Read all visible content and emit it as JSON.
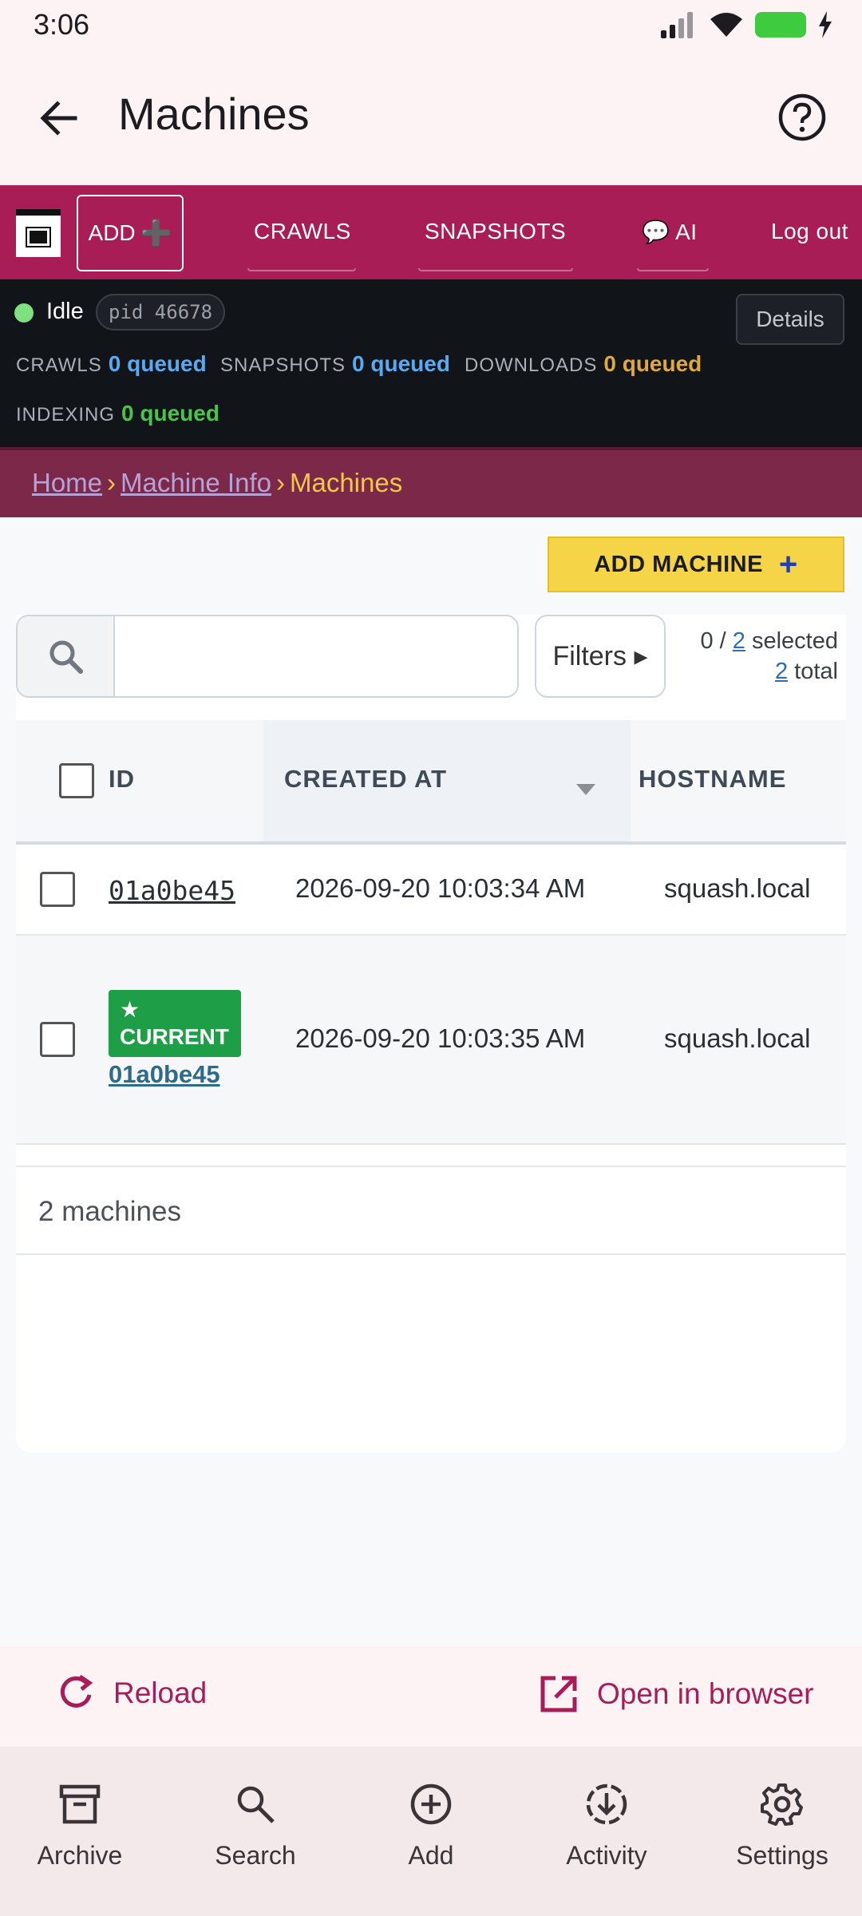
{
  "status_bar": {
    "time": "3:06"
  },
  "app_bar": {
    "title": "Machines"
  },
  "web_nav": {
    "add_label": "ADD",
    "links": [
      "CRAWLS",
      "SNAPSHOTS",
      "💬 AI"
    ],
    "logout": "Log out"
  },
  "worker_status": {
    "state": "Idle",
    "pid": "pid 46678",
    "details": "Details",
    "queues": [
      {
        "label": "CRAWLS",
        "value": "0 queued",
        "color": "#5aaaf0"
      },
      {
        "label": "SNAPSHOTS",
        "value": "0 queued",
        "color": "#5aaaf0"
      },
      {
        "label": "DOWNLOADS",
        "value": "0 queued",
        "color": "#e0a93b"
      },
      {
        "label": "INDEXING",
        "value": "0 queued",
        "color": "#4cc44c"
      }
    ]
  },
  "breadcrumb": {
    "home": "Home",
    "sep": "›",
    "machine_info": "Machine Info",
    "current": "Machines"
  },
  "toolbar": {
    "add_machine": "ADD MACHINE",
    "filters": "Filters ▸"
  },
  "selection": {
    "selected": "0",
    "of": "2",
    "selected_label": "selected",
    "total": "2",
    "total_label": "total"
  },
  "table": {
    "columns": [
      "ID",
      "CREATED AT",
      "HOSTNAME"
    ],
    "rows": [
      {
        "id": "01a0be45",
        "created_at": "2026-09-20 10:03:34 AM",
        "hostname": "squash.local",
        "current": false
      },
      {
        "id": "01a0be45",
        "created_at": "2026-09-20 10:03:35 AM",
        "hostname": "squash.local",
        "current": true,
        "badge": "CURRENT"
      }
    ],
    "footer": "2 machines"
  },
  "actions": {
    "reload": "Reload",
    "open_in_browser": "Open in browser"
  },
  "bottom_nav": [
    "Archive",
    "Search",
    "Add",
    "Activity",
    "Settings"
  ],
  "colors": {
    "brand": "#a91d57",
    "accent_yellow": "#f5d547",
    "badge_green": "#1e9e46"
  }
}
